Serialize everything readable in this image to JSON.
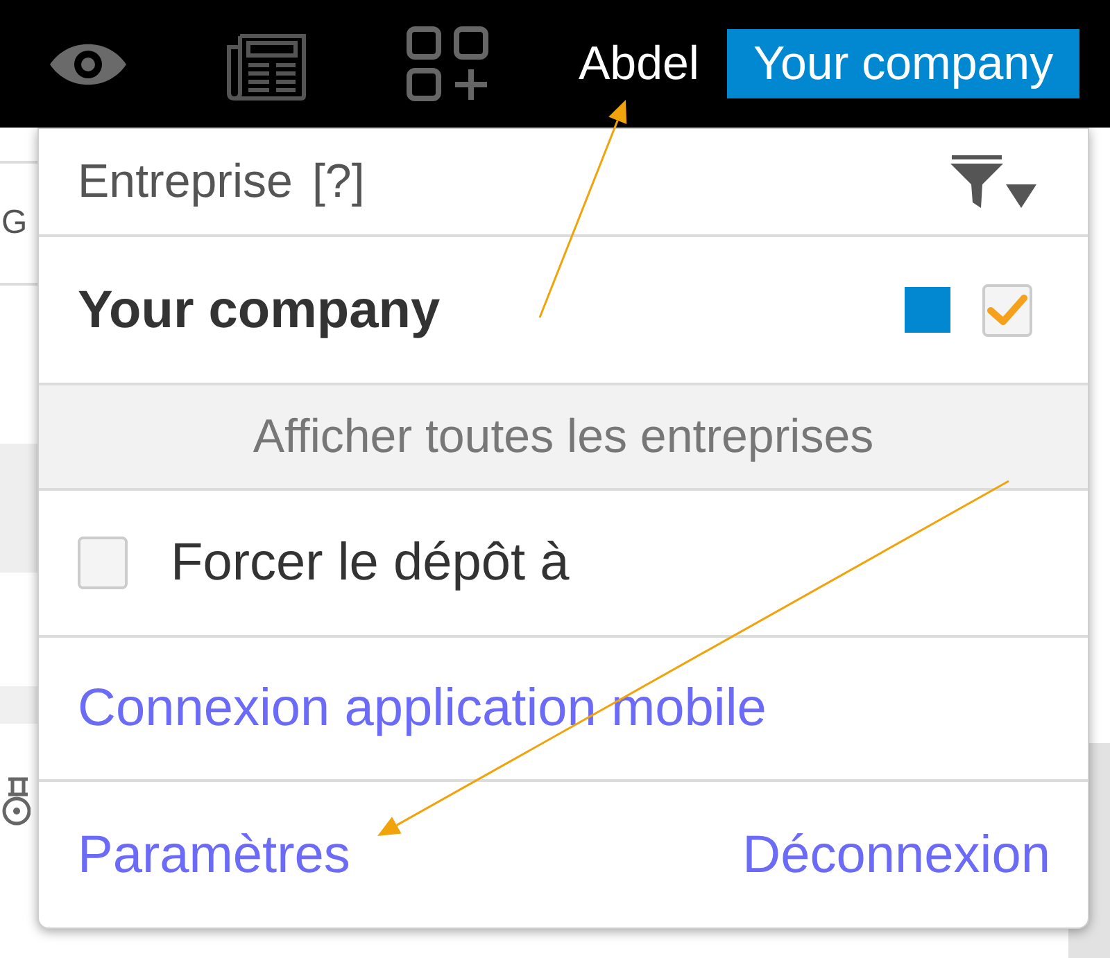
{
  "top_bar": {
    "user_name": "Abdel",
    "company_button": "Your company"
  },
  "page": {
    "heading_fragment": "G"
  },
  "dropdown": {
    "title": "Entreprise",
    "help": "[?]",
    "companies": [
      {
        "name": "Your company",
        "color": "#0288d1",
        "checked": true
      }
    ],
    "show_all": "Afficher toutes les entreprises",
    "options": [
      {
        "label": "Forcer le dépôt à",
        "checked": false
      }
    ],
    "mobile_link": "Connexion application mobile",
    "settings_link": "Paramètres",
    "logout_link": "Déconnexion"
  }
}
